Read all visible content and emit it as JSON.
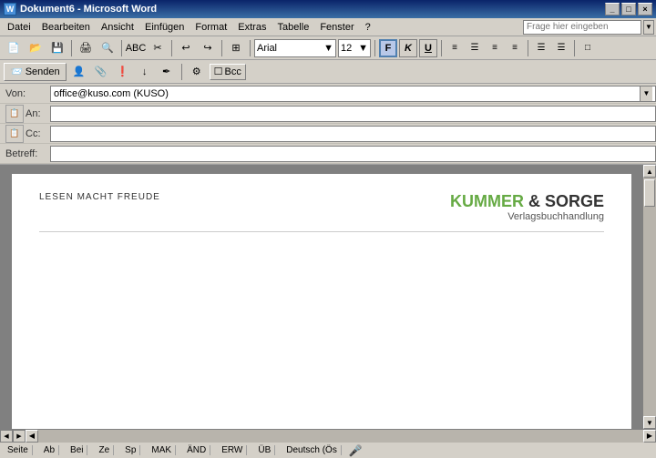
{
  "titlebar": {
    "title": "Dokument6 - Microsoft Word",
    "icon": "W",
    "buttons": [
      "_",
      "□",
      "×"
    ]
  },
  "menubar": {
    "items": [
      "Datei",
      "Bearbeiten",
      "Ansicht",
      "Einfügen",
      "Format",
      "Extras",
      "Tabelle",
      "Fenster",
      "?"
    ],
    "search_placeholder": "Frage hier eingeben"
  },
  "toolbar": {
    "font": "Arial",
    "size": "12",
    "undo_icon": "↩",
    "redo_icon": "↪"
  },
  "email_toolbar": {
    "send_label": "Senden",
    "bcc_label": "Bcc"
  },
  "email_fields": {
    "from_label": "Von:",
    "from_value": "office@kuso.com   (KUSO)",
    "to_label": "An:",
    "cc_label": "Cc:",
    "subject_label": "Betreff:"
  },
  "document": {
    "left_text": "LESEN MACHT FREUDE",
    "logo_kummer": "KUMMER",
    "logo_and": " & ",
    "logo_sorge": "SORGE",
    "logo_sub": "Verlagsbuchhandlung"
  },
  "statusbar": {
    "page": "Seite",
    "ab": "Ab",
    "bei": "Bei",
    "ze": "Ze",
    "sp": "Sp",
    "mak": "MAK",
    "and": "ÄND",
    "erw": "ERW",
    "ub": "ÜB",
    "language": "Deutsch (Ös"
  }
}
